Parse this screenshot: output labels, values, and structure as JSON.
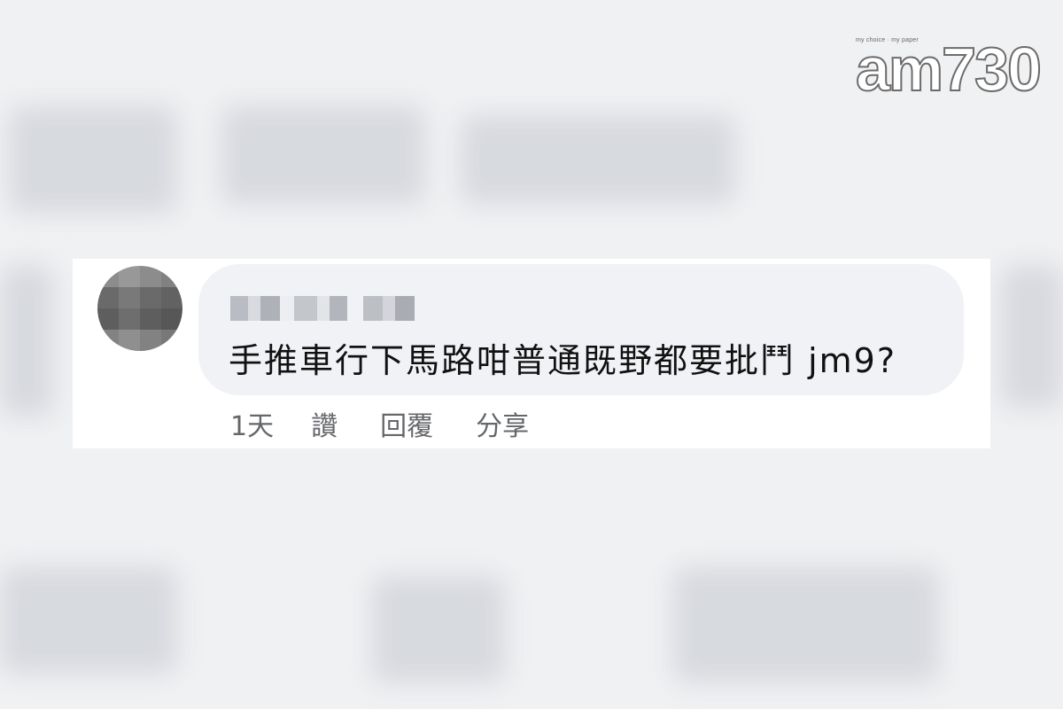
{
  "logo": {
    "tagline": "my choice · my paper",
    "text": "am730"
  },
  "comment": {
    "author_name": "",
    "body": "手推車行下馬路咁普通既野都要批鬥 jm9?",
    "timestamp": "1天",
    "actions": {
      "like": "讚",
      "reply": "回覆",
      "share": "分享"
    }
  },
  "colors": {
    "bubble": "#f0f2f5",
    "action_text": "#65676b",
    "body_text": "#111111"
  }
}
